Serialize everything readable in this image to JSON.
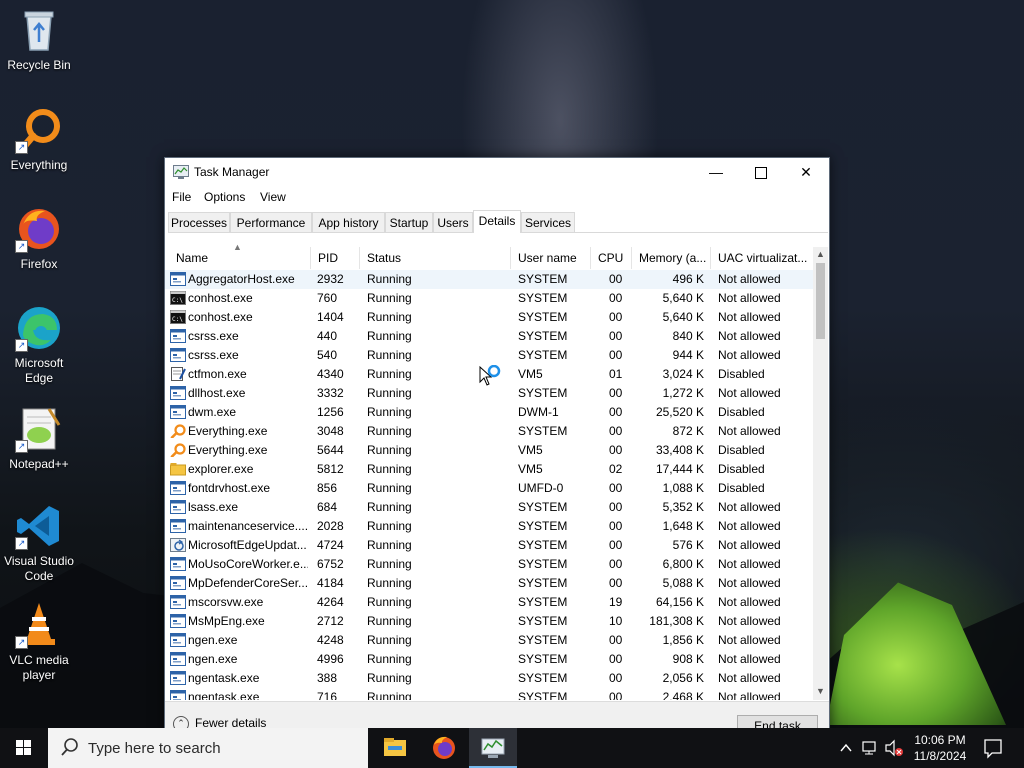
{
  "desktop": {
    "icons": [
      {
        "label": "Recycle Bin"
      },
      {
        "label": "Everything"
      },
      {
        "label": "Firefox"
      },
      {
        "label": "Microsoft Edge"
      },
      {
        "label": "Notepad++"
      },
      {
        "label": "Visual Studio Code"
      },
      {
        "label": "VLC media player"
      }
    ]
  },
  "window": {
    "title": "Task Manager",
    "menu": [
      "File",
      "Options",
      "View"
    ],
    "tabs": [
      "Processes",
      "Performance",
      "App history",
      "Startup",
      "Users",
      "Details",
      "Services"
    ],
    "active_tab": "Details",
    "columns": [
      "Name",
      "PID",
      "Status",
      "User name",
      "CPU",
      "Memory (a...",
      "UAC virtualizat..."
    ],
    "rows": [
      {
        "name": "AggregatorHost.exe",
        "pid": "2932",
        "status": "Running",
        "user": "SYSTEM",
        "cpu": "00",
        "mem": "496 K",
        "uac": "Not allowed",
        "icon": "generic"
      },
      {
        "name": "conhost.exe",
        "pid": "760",
        "status": "Running",
        "user": "SYSTEM",
        "cpu": "00",
        "mem": "5,640 K",
        "uac": "Not allowed",
        "icon": "console"
      },
      {
        "name": "conhost.exe",
        "pid": "1404",
        "status": "Running",
        "user": "SYSTEM",
        "cpu": "00",
        "mem": "5,640 K",
        "uac": "Not allowed",
        "icon": "console"
      },
      {
        "name": "csrss.exe",
        "pid": "440",
        "status": "Running",
        "user": "SYSTEM",
        "cpu": "00",
        "mem": "840 K",
        "uac": "Not allowed",
        "icon": "generic"
      },
      {
        "name": "csrss.exe",
        "pid": "540",
        "status": "Running",
        "user": "SYSTEM",
        "cpu": "00",
        "mem": "944 K",
        "uac": "Not allowed",
        "icon": "generic"
      },
      {
        "name": "ctfmon.exe",
        "pid": "4340",
        "status": "Running",
        "user": "VM5",
        "cpu": "01",
        "mem": "3,024 K",
        "uac": "Disabled",
        "icon": "notepad"
      },
      {
        "name": "dllhost.exe",
        "pid": "3332",
        "status": "Running",
        "user": "SYSTEM",
        "cpu": "00",
        "mem": "1,272 K",
        "uac": "Not allowed",
        "icon": "generic"
      },
      {
        "name": "dwm.exe",
        "pid": "1256",
        "status": "Running",
        "user": "DWM-1",
        "cpu": "00",
        "mem": "25,520 K",
        "uac": "Disabled",
        "icon": "generic"
      },
      {
        "name": "Everything.exe",
        "pid": "3048",
        "status": "Running",
        "user": "SYSTEM",
        "cpu": "00",
        "mem": "872 K",
        "uac": "Not allowed",
        "icon": "everything"
      },
      {
        "name": "Everything.exe",
        "pid": "5644",
        "status": "Running",
        "user": "VM5",
        "cpu": "00",
        "mem": "33,408 K",
        "uac": "Disabled",
        "icon": "everything"
      },
      {
        "name": "explorer.exe",
        "pid": "5812",
        "status": "Running",
        "user": "VM5",
        "cpu": "02",
        "mem": "17,444 K",
        "uac": "Disabled",
        "icon": "folder"
      },
      {
        "name": "fontdrvhost.exe",
        "pid": "856",
        "status": "Running",
        "user": "UMFD-0",
        "cpu": "00",
        "mem": "1,088 K",
        "uac": "Disabled",
        "icon": "generic"
      },
      {
        "name": "lsass.exe",
        "pid": "684",
        "status": "Running",
        "user": "SYSTEM",
        "cpu": "00",
        "mem": "5,352 K",
        "uac": "Not allowed",
        "icon": "generic"
      },
      {
        "name": "maintenanceservice....",
        "pid": "2028",
        "status": "Running",
        "user": "SYSTEM",
        "cpu": "00",
        "mem": "1,648 K",
        "uac": "Not allowed",
        "icon": "generic"
      },
      {
        "name": "MicrosoftEdgeUpdat...",
        "pid": "4724",
        "status": "Running",
        "user": "SYSTEM",
        "cpu": "00",
        "mem": "576 K",
        "uac": "Not allowed",
        "icon": "update"
      },
      {
        "name": "MoUsoCoreWorker.e...",
        "pid": "6752",
        "status": "Running",
        "user": "SYSTEM",
        "cpu": "00",
        "mem": "6,800 K",
        "uac": "Not allowed",
        "icon": "generic"
      },
      {
        "name": "MpDefenderCoreSer...",
        "pid": "4184",
        "status": "Running",
        "user": "SYSTEM",
        "cpu": "00",
        "mem": "5,088 K",
        "uac": "Not allowed",
        "icon": "generic"
      },
      {
        "name": "mscorsvw.exe",
        "pid": "4264",
        "status": "Running",
        "user": "SYSTEM",
        "cpu": "19",
        "mem": "64,156 K",
        "uac": "Not allowed",
        "icon": "generic"
      },
      {
        "name": "MsMpEng.exe",
        "pid": "2712",
        "status": "Running",
        "user": "SYSTEM",
        "cpu": "10",
        "mem": "181,308 K",
        "uac": "Not allowed",
        "icon": "generic"
      },
      {
        "name": "ngen.exe",
        "pid": "4248",
        "status": "Running",
        "user": "SYSTEM",
        "cpu": "00",
        "mem": "1,856 K",
        "uac": "Not allowed",
        "icon": "generic"
      },
      {
        "name": "ngen.exe",
        "pid": "4996",
        "status": "Running",
        "user": "SYSTEM",
        "cpu": "00",
        "mem": "908 K",
        "uac": "Not allowed",
        "icon": "generic"
      },
      {
        "name": "ngentask.exe",
        "pid": "388",
        "status": "Running",
        "user": "SYSTEM",
        "cpu": "00",
        "mem": "2,056 K",
        "uac": "Not allowed",
        "icon": "generic"
      },
      {
        "name": "ngentask.exe",
        "pid": "716",
        "status": "Running",
        "user": "SYSTEM",
        "cpu": "00",
        "mem": "2,468 K",
        "uac": "Not allowed",
        "icon": "generic"
      }
    ],
    "footer": {
      "fewer_details": "Fewer details",
      "end_task": "End task"
    }
  },
  "taskbar": {
    "search_placeholder": "Type here to search",
    "time": "10:06 PM",
    "date": "11/8/2024"
  },
  "colors": {
    "accent": "#76b9ed",
    "selected_row": "#eef5fb"
  }
}
